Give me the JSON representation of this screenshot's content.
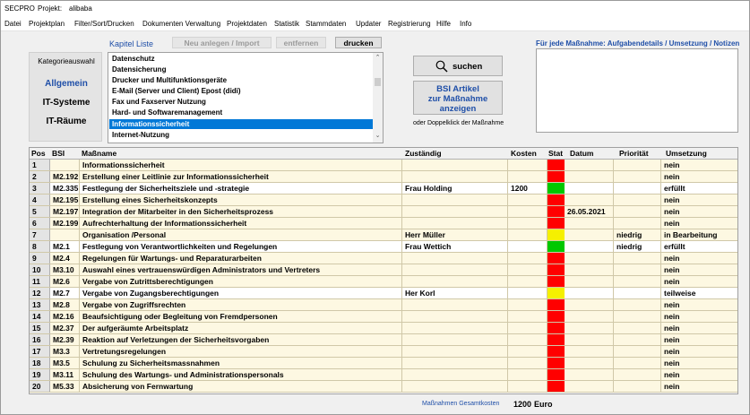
{
  "window": {
    "app_name": "SECPRO",
    "project_label": "Projekt:",
    "project_name": "alibaba"
  },
  "menu": [
    "Datei",
    "Projektplan",
    "Filter/Sort/Drucken",
    "Dokumenten Verwaltung",
    "Projektdaten",
    "Statistik",
    "Stammdaten",
    "Updater",
    "Registrierung",
    "Hilfe",
    "Info"
  ],
  "category": {
    "title": "Kategorieauswahl",
    "items": [
      {
        "label": "Allgemein",
        "active": true
      },
      {
        "label": "IT-Systeme",
        "active": false
      },
      {
        "label": "IT-Räume",
        "active": false
      }
    ]
  },
  "kapitel": {
    "label": "Kapitel Liste",
    "new_button": "Neu anlegen / Import",
    "remove_button": "entfernen",
    "print_button": "drucken",
    "items": [
      "Datenschutz",
      "Datensicherung",
      "Drucker und Multifunktionsgeräte",
      "E-Mail (Server und Client) Epost (didi)",
      "Fax und Faxserver Nutzung",
      "Hard- und Softwaremanagement",
      "Informationssicherheit",
      "Internet-Nutzung"
    ],
    "selected_index": 6
  },
  "actions": {
    "search_label": "suchen",
    "bsi_line1": "BSI Artikel",
    "bsi_line2": "zur Maßnahme",
    "bsi_line3": "anzeigen",
    "hint": "oder Doppelklick der Maßnahme"
  },
  "notes": {
    "label": "Für jede Maßnahme:  Aufgabendetails / Umsetzung / Notizen"
  },
  "colors": {
    "red": "#ff0000",
    "green": "#00c800",
    "yellow": "#f5f000",
    "accent": "#1f4fa8",
    "selection": "#0078d7"
  },
  "grid": {
    "columns": [
      "Pos",
      "BSI",
      "Maßname",
      "Zuständig",
      "Kosten",
      "Stat",
      "Datum",
      "Priorität",
      "Umsetzung"
    ],
    "rows": [
      {
        "pos": "1",
        "bsi": "",
        "name": "Informationssicherheit",
        "zust": "",
        "kosten": "",
        "stat": "red",
        "datum": "",
        "prio": "",
        "ums": "nein",
        "cream": true
      },
      {
        "pos": "2",
        "bsi": "M2.192",
        "name": "Erstellung einer Leitlinie zur Informationssicherheit",
        "zust": "",
        "kosten": "",
        "stat": "red",
        "datum": "",
        "prio": "",
        "ums": "nein",
        "cream": true
      },
      {
        "pos": "3",
        "bsi": "M2.335",
        "name": "Festlegung der Sicherheitsziele und -strategie",
        "zust": "Frau Holding",
        "kosten": "1200",
        "stat": "green",
        "datum": "",
        "prio": "",
        "ums": "erfüllt",
        "cream": false
      },
      {
        "pos": "4",
        "bsi": "M2.195",
        "name": "Erstellung eines Sicherheitskonzepts",
        "zust": "",
        "kosten": "",
        "stat": "red",
        "datum": "",
        "prio": "",
        "ums": "nein",
        "cream": true
      },
      {
        "pos": "5",
        "bsi": "M2.197",
        "name": "Integration der Mitarbeiter in den Sicherheitsprozess",
        "zust": "",
        "kosten": "",
        "stat": "red",
        "datum": "26.05.2021",
        "prio": "",
        "ums": "nein",
        "cream": true
      },
      {
        "pos": "6",
        "bsi": "M2.199",
        "name": "Aufrechterhaltung der Informationssicherheit",
        "zust": "",
        "kosten": "",
        "stat": "red",
        "datum": "",
        "prio": "",
        "ums": "nein",
        "cream": true
      },
      {
        "pos": "7",
        "bsi": "",
        "name": "Organisation /Personal",
        "zust": "Herr Müller",
        "kosten": "",
        "stat": "yellow",
        "datum": "",
        "prio": "niedrig",
        "ums": "in Bearbeitung",
        "cream": true
      },
      {
        "pos": "8",
        "bsi": "M2.1",
        "name": "Festlegung von Verantwortlichkeiten und Regelungen",
        "zust": "Frau Wettich",
        "kosten": "",
        "stat": "green",
        "datum": "",
        "prio": "niedrig",
        "ums": "erfüllt",
        "cream": false
      },
      {
        "pos": "9",
        "bsi": "M2.4",
        "name": "Regelungen für Wartungs- und Reparaturarbeiten",
        "zust": "",
        "kosten": "",
        "stat": "red",
        "datum": "",
        "prio": "",
        "ums": "nein",
        "cream": true
      },
      {
        "pos": "10",
        "bsi": "M3.10",
        "name": "Auswahl eines vertrauenswürdigen Administrators und Vertreters",
        "zust": "",
        "kosten": "",
        "stat": "red",
        "datum": "",
        "prio": "",
        "ums": "nein",
        "cream": true
      },
      {
        "pos": "11",
        "bsi": "M2.6",
        "name": "Vergabe von Zutrittsberechtigungen",
        "zust": "",
        "kosten": "",
        "stat": "red",
        "datum": "",
        "prio": "",
        "ums": "nein",
        "cream": true
      },
      {
        "pos": "12",
        "bsi": "M2.7",
        "name": "Vergabe von Zugangsberechtigungen",
        "zust": "Her Korl",
        "kosten": "",
        "stat": "yellow",
        "datum": "",
        "prio": "",
        "ums": "teilweise",
        "cream": false
      },
      {
        "pos": "13",
        "bsi": "M2.8",
        "name": "Vergabe von Zugriffsrechten",
        "zust": "",
        "kosten": "",
        "stat": "red",
        "datum": "",
        "prio": "",
        "ums": "nein",
        "cream": true
      },
      {
        "pos": "14",
        "bsi": "M2.16",
        "name": "Beaufsichtigung oder Begleitung von Fremdpersonen",
        "zust": "",
        "kosten": "",
        "stat": "red",
        "datum": "",
        "prio": "",
        "ums": "nein",
        "cream": true
      },
      {
        "pos": "15",
        "bsi": "M2.37",
        "name": "Der aufgeräumte Arbeitsplatz",
        "zust": "",
        "kosten": "",
        "stat": "red",
        "datum": "",
        "prio": "",
        "ums": "nein",
        "cream": true
      },
      {
        "pos": "16",
        "bsi": "M2.39",
        "name": "Reaktion auf Verletzungen der Sicherheitsvorgaben",
        "zust": "",
        "kosten": "",
        "stat": "red",
        "datum": "",
        "prio": "",
        "ums": "nein",
        "cream": true
      },
      {
        "pos": "17",
        "bsi": "M3.3",
        "name": "Vertretungsregelungen",
        "zust": "",
        "kosten": "",
        "stat": "red",
        "datum": "",
        "prio": "",
        "ums": "nein",
        "cream": true
      },
      {
        "pos": "18",
        "bsi": "M3.5",
        "name": "Schulung zu Sicherheitsmassnahmen",
        "zust": "",
        "kosten": "",
        "stat": "red",
        "datum": "",
        "prio": "",
        "ums": "nein",
        "cream": true
      },
      {
        "pos": "19",
        "bsi": "M3.11",
        "name": "Schulung des Wartungs- und Administrationspersonals",
        "zust": "",
        "kosten": "",
        "stat": "red",
        "datum": "",
        "prio": "",
        "ums": "nein",
        "cream": true
      },
      {
        "pos": "20",
        "bsi": "M5.33",
        "name": "Absicherung von Fernwartung",
        "zust": "",
        "kosten": "",
        "stat": "red",
        "datum": "",
        "prio": "",
        "ums": "nein",
        "cream": true
      }
    ]
  },
  "footer": {
    "label": "Maßnahmen Gesamtkosten",
    "total": "1200",
    "currency": "Euro"
  }
}
